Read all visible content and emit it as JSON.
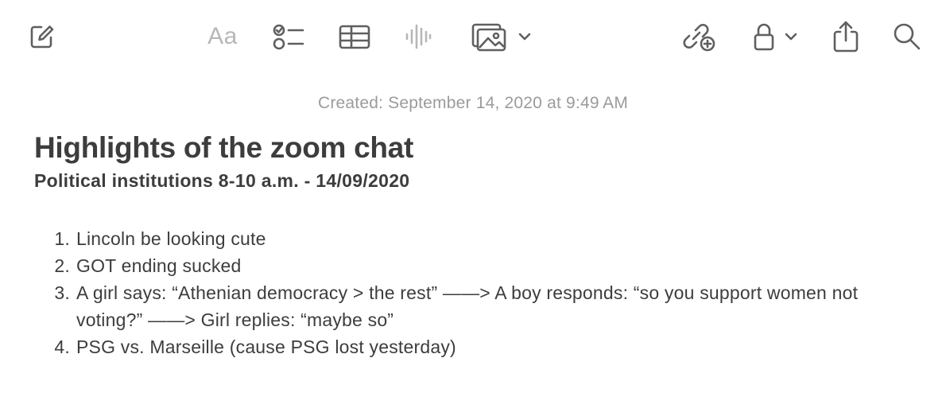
{
  "toolbar": {
    "compose_icon": "compose-icon",
    "format_label": "Aa",
    "checklist_icon": "checklist-icon",
    "table_icon": "table-icon",
    "audio_icon": "waveform-icon",
    "media_icon": "photo-icon",
    "collaborate_icon": "link-plus-icon",
    "lock_icon": "lock-icon",
    "share_icon": "share-icon",
    "search_icon": "search-icon"
  },
  "note": {
    "created": "Created: September 14, 2020 at 9:49 AM",
    "title": "Highlights of the zoom chat",
    "subtitle": "Political institutions 8-10 a.m. - 14/09/2020",
    "items": [
      {
        "number": "1.",
        "text": "Lincoln be looking cute"
      },
      {
        "number": "2.",
        "text": "GOT ending sucked"
      },
      {
        "number": "3.",
        "text": "A girl says: “Athenian democracy > the rest” ——> A boy responds: “so you support women not voting?” ——> Girl replies: “maybe so”"
      },
      {
        "number": "4.",
        "text": "PSG vs. Marseille (cause PSG lost yesterday)"
      }
    ]
  },
  "colors": {
    "icon": "#5f5f5f",
    "icon_disabled": "#b7b7b7",
    "text": "#3d3d3d",
    "meta": "#9b9b9b"
  }
}
